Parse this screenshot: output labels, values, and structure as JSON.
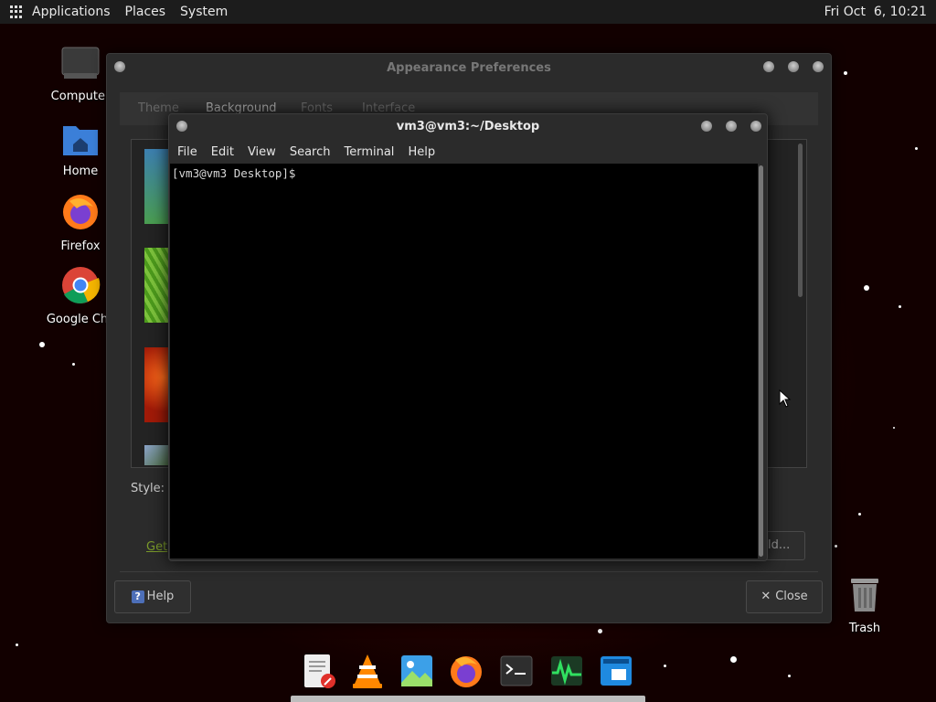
{
  "top_panel": {
    "menus": [
      "Applications",
      "Places",
      "System"
    ],
    "clock": "Fri Oct  6, 10:21"
  },
  "desktop_icons": {
    "computer": "Computer",
    "home": "Home",
    "firefox": "Firefox",
    "chrome": "Google Chro",
    "trash": "Trash"
  },
  "appearance": {
    "title": "Appearance Preferences",
    "tabs": [
      "Theme",
      "Background",
      "Fonts",
      "Interface"
    ],
    "style_label": "Style:",
    "get_link": "Get",
    "add_button_partial": "ld...",
    "help_button": "Help",
    "close_button": "Close"
  },
  "terminal": {
    "title": "vm3@vm3:~/Desktop",
    "menus": [
      "File",
      "Edit",
      "View",
      "Search",
      "Terminal",
      "Help"
    ],
    "prompt": "[vm3@vm3 Desktop]$"
  },
  "dock": {
    "items": [
      "text-editor-icon",
      "vlc-icon",
      "image-viewer-icon",
      "firefox-icon",
      "terminal-icon",
      "system-monitor-icon",
      "window-manager-icon"
    ]
  },
  "colors": {
    "panel_bg": "#1c1c1c",
    "window_bg": "#2b2b2b",
    "terminal_bg": "#000000",
    "link": "#7a9a2a"
  }
}
